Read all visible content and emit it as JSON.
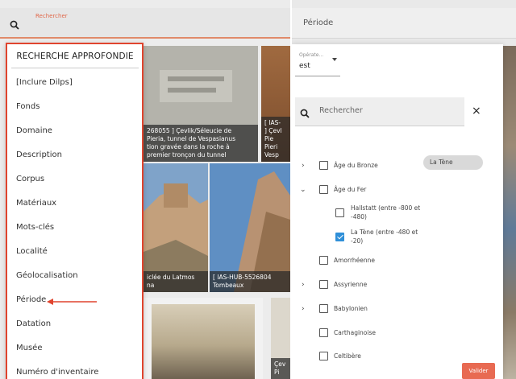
{
  "left": {
    "search_placeholder": "Rechercher",
    "thumb1_caption": "268055 ] Çevlik/Séleucie de\n Pieria, tunnel de Vespasianus\ntion gravée dans la roche à\npremier tronçon du tunnel",
    "thumb2_caption": "[ IAS-\n] Çevl\nPie\nPieri\nVesp",
    "thumb3_caption": "iclée du Latmos\nna",
    "thumb4_caption": "[ IAS-HUB-5526804\nTombeaux",
    "thumb6_caption": "Çev\nPi",
    "menu": {
      "title": "RECHERCHE APPROFONDIE",
      "items": [
        "[Inclure Dilps]",
        "Fonds",
        "Domaine",
        "Description",
        "Corpus",
        "Matériaux",
        "Mots-clés",
        "Localité",
        "Géolocalisation",
        "Période",
        "Datation",
        "Musée",
        "Numéro d'inventaire"
      ]
    }
  },
  "right": {
    "header_title": "Période",
    "operator": {
      "label": "Opérate...",
      "value": "est"
    },
    "search_placeholder": "Rechercher",
    "close_glyph": "×",
    "chip": "La Tène",
    "tree": [
      {
        "label": "Âge du Bronze",
        "expandable": true,
        "expanded": false,
        "checked": false,
        "level": 0
      },
      {
        "label": "Âge du Fer",
        "expandable": true,
        "expanded": true,
        "checked": false,
        "level": 0
      },
      {
        "label": "Hallstatt (entre -800 et\n-480)",
        "expandable": false,
        "checked": false,
        "level": 1
      },
      {
        "label": "La Tène (entre -480 et\n-20)",
        "expandable": false,
        "checked": true,
        "level": 1
      },
      {
        "label": "Amorrhéenne",
        "expandable": false,
        "checked": false,
        "level": 0
      },
      {
        "label": "Assyrienne",
        "expandable": true,
        "expanded": false,
        "checked": false,
        "level": 0
      },
      {
        "label": "Babylonien",
        "expandable": true,
        "expanded": false,
        "checked": false,
        "level": 0
      },
      {
        "label": "Carthaginoise",
        "expandable": false,
        "checked": false,
        "level": 0
      },
      {
        "label": "Celtibère",
        "expandable": false,
        "checked": false,
        "level": 0
      }
    ],
    "submit": "Valider"
  },
  "colors": {
    "highlight_red": "#e0442e",
    "checkbox_blue": "#2f8fd8",
    "submit_orange": "#e86a52"
  }
}
